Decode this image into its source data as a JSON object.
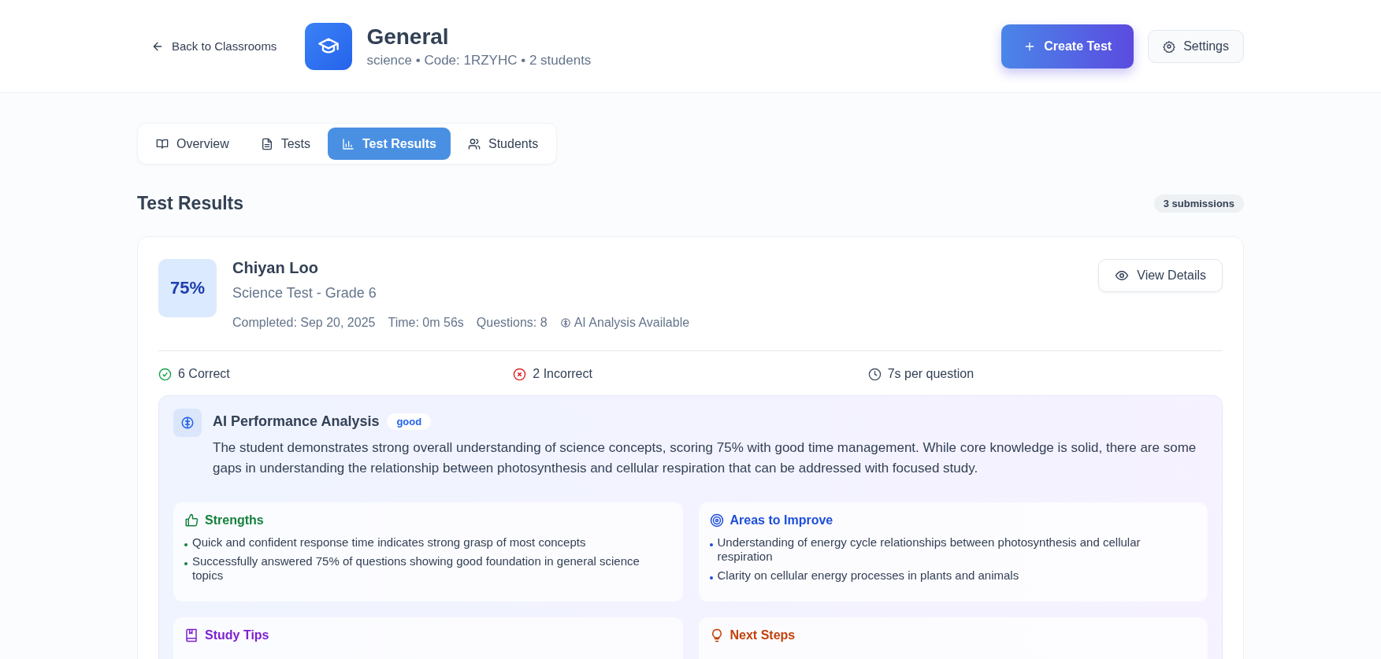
{
  "header": {
    "back_link": "Back to Classrooms",
    "title": "General",
    "subtitle": "science • Code: 1RZYHC • 2 students",
    "create_button": "Create Test",
    "settings_button": "Settings"
  },
  "tabs": [
    {
      "label": "Overview",
      "kind": "book",
      "selected": false
    },
    {
      "label": "Tests",
      "kind": "file",
      "selected": false
    },
    {
      "label": "Test Results",
      "kind": "chart",
      "selected": true
    },
    {
      "label": "Students",
      "kind": "users",
      "selected": false
    }
  ],
  "section": {
    "title": "Test Results",
    "count_badge": "3 submissions"
  },
  "result": {
    "score": "75%",
    "student": "Chiyan Loo",
    "test": "Science Test - Grade 6",
    "completed": "Completed: Sep 20, 2025",
    "time": "Time: 0m 56s",
    "questions": "Questions: 8",
    "ai_flag": "AI Analysis Available",
    "view_button": "View Details",
    "stats": [
      {
        "kind": "correct",
        "text": "6 Correct"
      },
      {
        "kind": "incorrect",
        "text": "2 Incorrect"
      },
      {
        "kind": "time",
        "text": "7s per question"
      }
    ],
    "analysis": {
      "title": "AI Performance Analysis",
      "rating": "good",
      "summary": "The student demonstrates strong overall understanding of science concepts, scoring 75% with good time management. While core knowledge is solid, there are some gaps in understanding the relationship between photosynthesis and cellular respiration that can be addressed with focused study.",
      "sections": [
        {
          "kind": "strengths",
          "title": "Strengths",
          "color": "#15803d",
          "items": [
            "Quick and confident response time indicates strong grasp of most concepts",
            "Successfully answered 75% of questions showing good foundation in general science topics"
          ]
        },
        {
          "kind": "improve",
          "title": "Areas to Improve",
          "color": "#1d4ed8",
          "items": [
            "Understanding of energy cycle relationships between photosynthesis and cellular respiration",
            "Clarity on cellular energy processes in plants and animals"
          ]
        },
        {
          "kind": "tips",
          "title": "Study Tips",
          "color": "#7e22ce"
        },
        {
          "kind": "next",
          "title": "Next Steps",
          "color": "#c2410c"
        }
      ]
    }
  }
}
